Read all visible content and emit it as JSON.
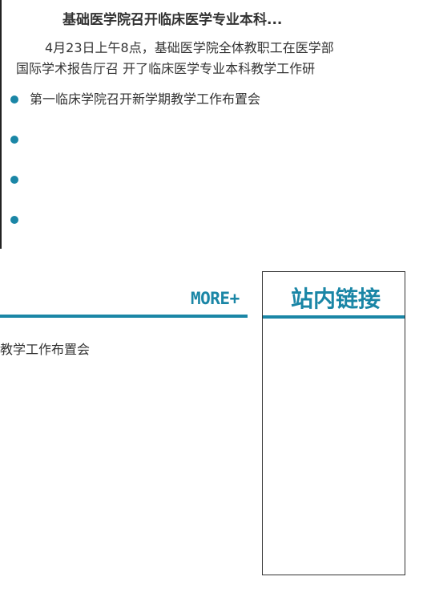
{
  "news": {
    "title": "基础医学院召开临床医学专业本科...",
    "summary_line1": "4月23日上午8点，基础医学院全体教职工在医学部",
    "summary_line2": "国际学术报告厅召 开了临床医学专业本科教学工作研",
    "items": [
      {
        "text": "第一临床学院召开新学期教学工作布置会"
      },
      {
        "text": ""
      },
      {
        "text": ""
      },
      {
        "text": ""
      }
    ]
  },
  "section": {
    "more_label": "MORE+",
    "partial_item": "教学工作布置会"
  },
  "links_panel": {
    "title": "站内链接"
  },
  "colors": {
    "accent": "#1a86a6",
    "text": "#333333",
    "border": "#333333"
  }
}
